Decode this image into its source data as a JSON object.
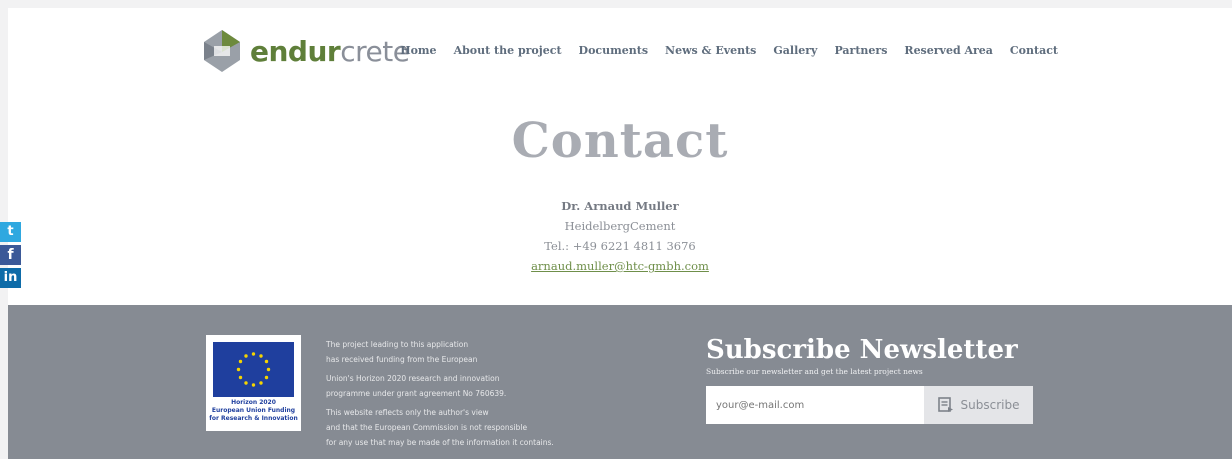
{
  "header": {
    "logo_text_a": "endur",
    "logo_text_b": "crete",
    "nav": [
      "Home",
      "About the project",
      "Documents",
      "News & Events",
      "Gallery",
      "Partners",
      "Reserved Area",
      "Contact"
    ]
  },
  "main": {
    "title": "Contact",
    "contact": {
      "name": "Dr. Arnaud Muller",
      "company": "HeidelbergCement",
      "phone": "Tel.: +49 6221 4811 3676",
      "email": "arnaud.muller@htc-gmbh.com"
    }
  },
  "social": {
    "twitter_glyph": "t",
    "facebook_glyph": "f",
    "linkedin_glyph": "in"
  },
  "footer": {
    "eu_caption_1": "Horizon 2020",
    "eu_caption_2": "European Union Funding",
    "eu_caption_3": "for Research & Innovation",
    "text_1a": "The project leading to this application",
    "text_1b": "has received funding from the European",
    "text_2a": "Union's Horizon 2020 research and innovation",
    "text_2b": "programme under grant agreement No 760639.",
    "text_3a": "This website reflects only the author's view",
    "text_3b": "and that the European Commission is not responsible",
    "text_3c": "for any use that may be made of the information it contains.",
    "newsletter_title": "Subscribe Newsletter",
    "newsletter_sub": "Subscribe our newsletter and get the latest project news",
    "email_placeholder": "your@e-mail.com",
    "subscribe_label": "Subscribe"
  },
  "colors": {
    "brand_green": "#5f7f3a",
    "footer_bg": "#868b93",
    "eu_blue": "#1f3f9e",
    "star_yellow": "#f5d400"
  },
  "icons": [
    "logo-mark-icon",
    "twitter-icon",
    "facebook-icon",
    "linkedin-icon",
    "eu-flag-icon",
    "subscribe-icon"
  ]
}
